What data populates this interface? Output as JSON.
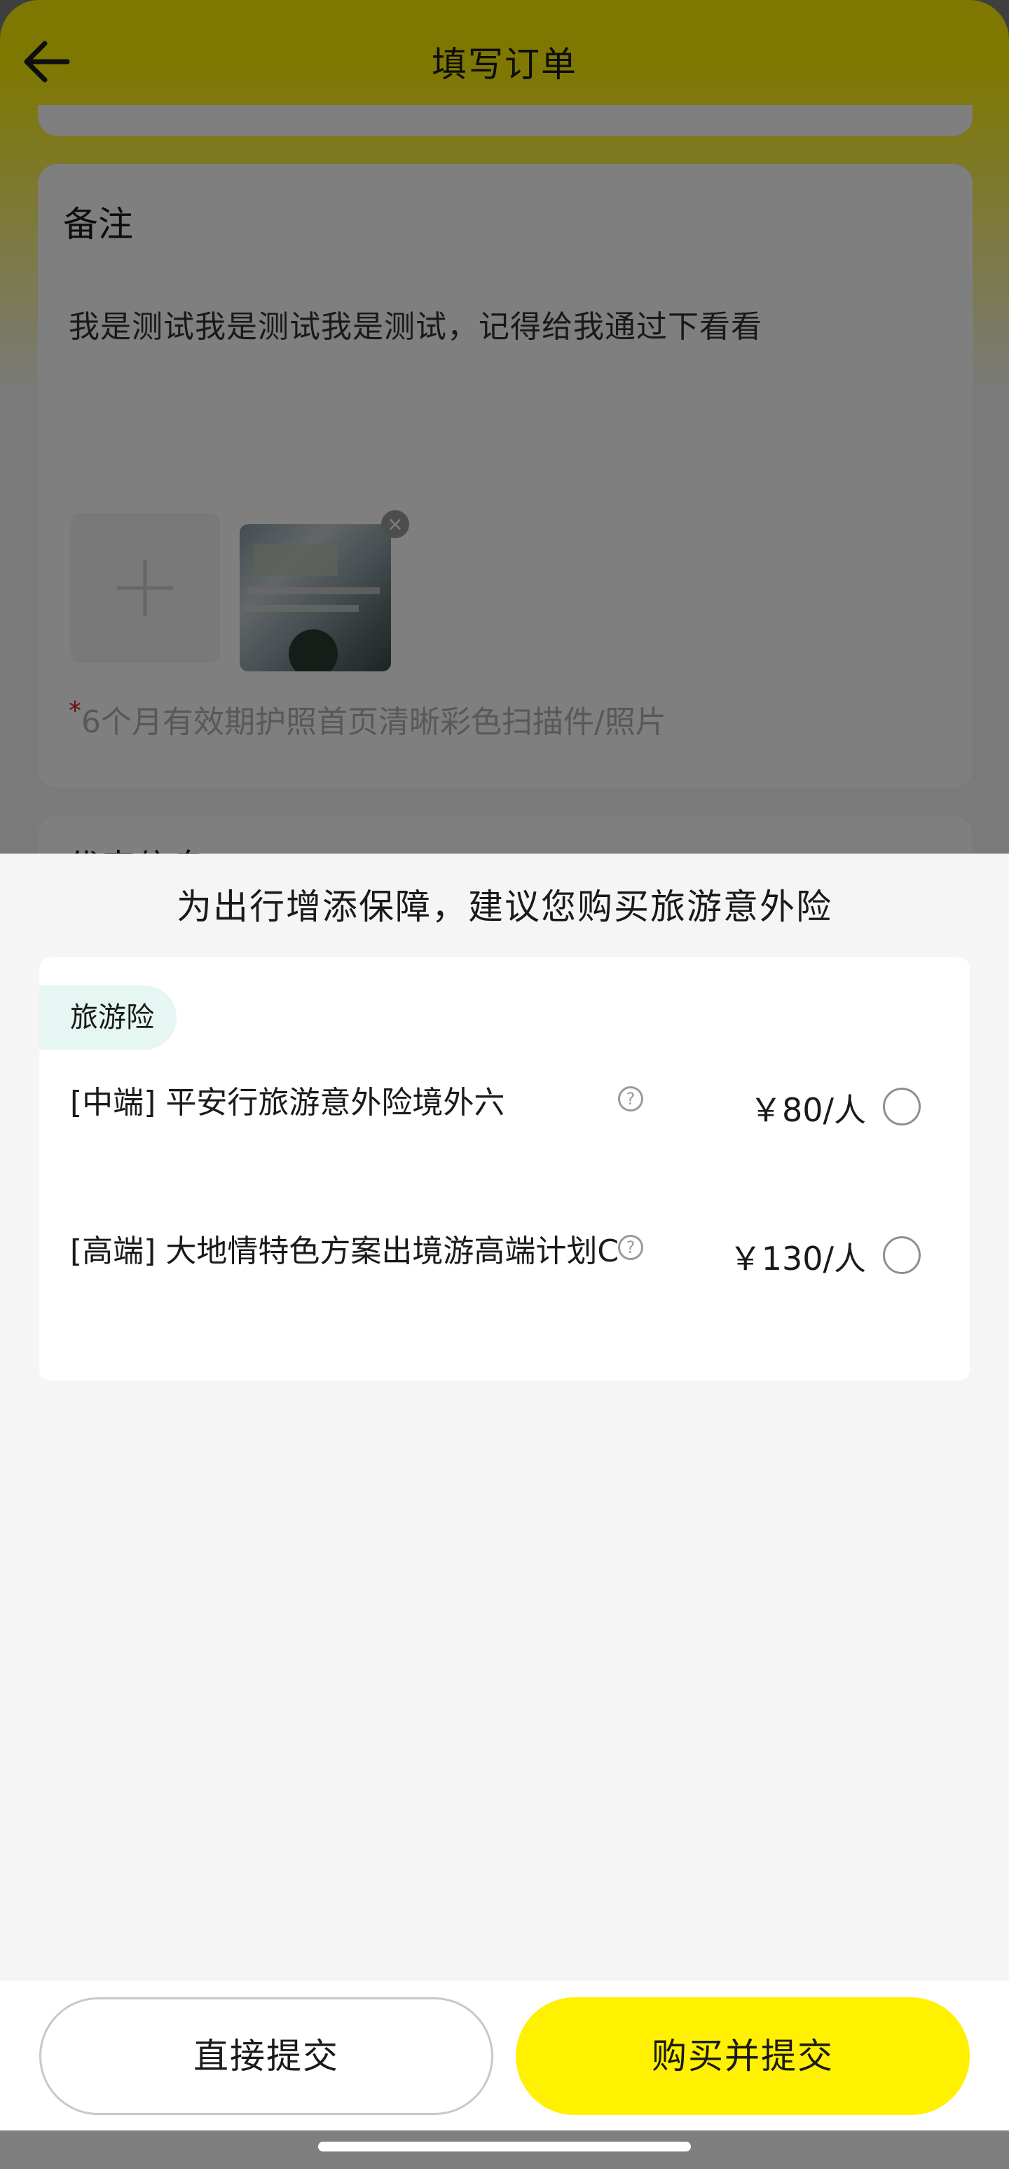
{
  "header": {
    "title": "填写订单"
  },
  "remark": {
    "title": "备注",
    "text": "我是测试我是测试我是测试，记得给我通过下看看",
    "hint_star": "*",
    "hint": "6个月有效期护照首页清晰彩色扫描件/照片"
  },
  "next_section": {
    "title": "代表信息"
  },
  "insurance_sheet": {
    "title": "为出行增添保障，建议您购买旅游意外险",
    "category_tag": "旅游险",
    "items": [
      {
        "name": "[中端] 平安行旅游意外险境外六",
        "price": "￥80/人",
        "selected": false
      },
      {
        "name": "[高端] 大地情特色方案出境游高端计划C",
        "price": "￥130/人",
        "selected": false
      }
    ]
  },
  "footer": {
    "direct_submit": "直接提交",
    "buy_submit": "购买并提交"
  },
  "colors": {
    "accent_yellow": "#fff100",
    "tag_bg": "#e6f6f2",
    "required_star": "#e02020"
  },
  "icons": {
    "back": "arrow-left-icon",
    "help": "question-circle-icon",
    "close": "close-icon",
    "add": "plus-icon"
  }
}
